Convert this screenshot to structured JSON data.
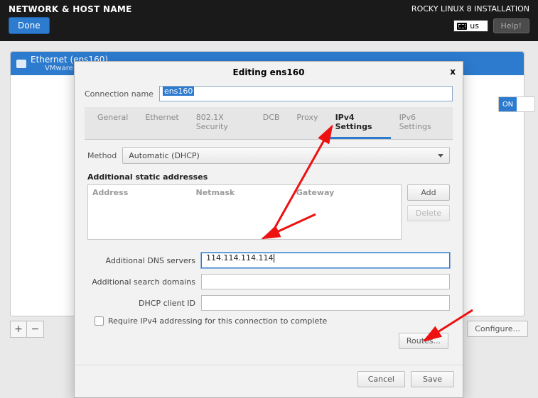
{
  "topbar": {
    "title": "NETWORK & HOST NAME",
    "subtitle": "ROCKY LINUX 8 INSTALLATION",
    "done": "Done",
    "help": "Help!",
    "keyboard": "us"
  },
  "nic": {
    "title": "Ethernet (ens160)",
    "sub": "VMware VMXN",
    "toggle_on": "ON"
  },
  "buttons": {
    "plus": "+",
    "minus": "−",
    "configure": "Configure..."
  },
  "dialog": {
    "title": "Editing ens160",
    "close": "x",
    "conn_name_label": "Connection name",
    "conn_name_value": "ens160",
    "tabs": {
      "general": "General",
      "ethernet": "Ethernet",
      "sec": "802.1X Security",
      "dcb": "DCB",
      "proxy": "Proxy",
      "ipv4": "IPv4 Settings",
      "ipv6": "IPv6 Settings"
    },
    "method_label": "Method",
    "method_value": "Automatic (DHCP)",
    "addr_section": "Additional static addresses",
    "addr_headers": {
      "address": "Address",
      "netmask": "Netmask",
      "gateway": "Gateway"
    },
    "add": "Add",
    "delete": "Delete",
    "dns_label": "Additional DNS servers",
    "dns_value": "114.114.114.114",
    "search_label": "Additional search domains",
    "search_value": "",
    "dhcp_label": "DHCP client ID",
    "dhcp_value": "",
    "require_label": "Require IPv4 addressing for this connection to complete",
    "routes": "Routes...",
    "cancel": "Cancel",
    "save": "Save"
  }
}
